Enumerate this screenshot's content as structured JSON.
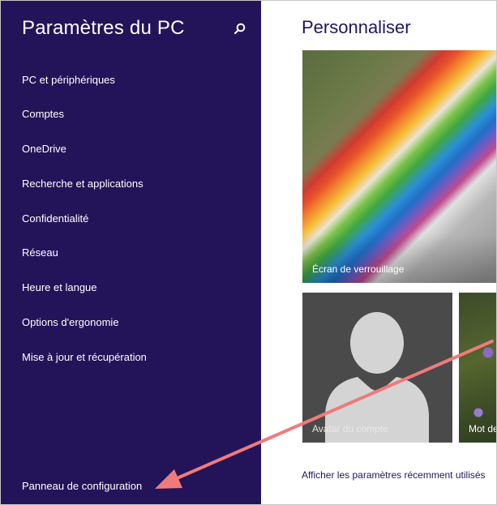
{
  "sidebar": {
    "title": "Paramètres du PC",
    "search_icon": "search-icon",
    "items": [
      {
        "label": "PC et périphériques"
      },
      {
        "label": "Comptes"
      },
      {
        "label": "OneDrive"
      },
      {
        "label": "Recherche et applications"
      },
      {
        "label": "Confidentialité"
      },
      {
        "label": "Réseau"
      },
      {
        "label": "Heure et langue"
      },
      {
        "label": "Options d'ergonomie"
      },
      {
        "label": "Mise à jour et récupération"
      }
    ],
    "control_panel_label": "Panneau de configuration"
  },
  "main": {
    "title": "Personnaliser",
    "tiles": [
      {
        "label": "Écran de verrouillage"
      },
      {
        "label": "Avatar du compte"
      },
      {
        "label": "Mot de"
      }
    ],
    "recent_link": "Afficher les paramètres récemment utilisés"
  },
  "colors": {
    "sidebar_bg": "#23145a",
    "accent": "#23145a",
    "annotation_arrow": "#f07a7a"
  }
}
